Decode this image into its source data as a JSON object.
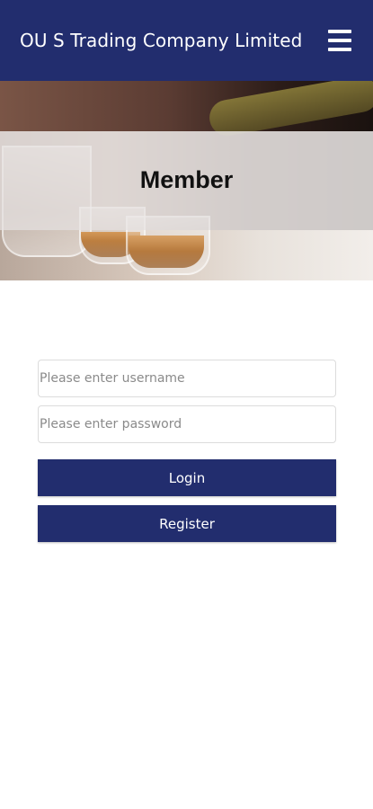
{
  "header": {
    "title": "OU S Trading Company Limited",
    "menu_icon": "hamburger-menu-icon"
  },
  "banner": {
    "title": "Member"
  },
  "login_form": {
    "username_placeholder": "Please enter username",
    "password_placeholder": "Please enter password",
    "login_label": "Login",
    "register_label": "Register"
  },
  "colors": {
    "brand": "#222d6e",
    "background": "#ffffff"
  }
}
